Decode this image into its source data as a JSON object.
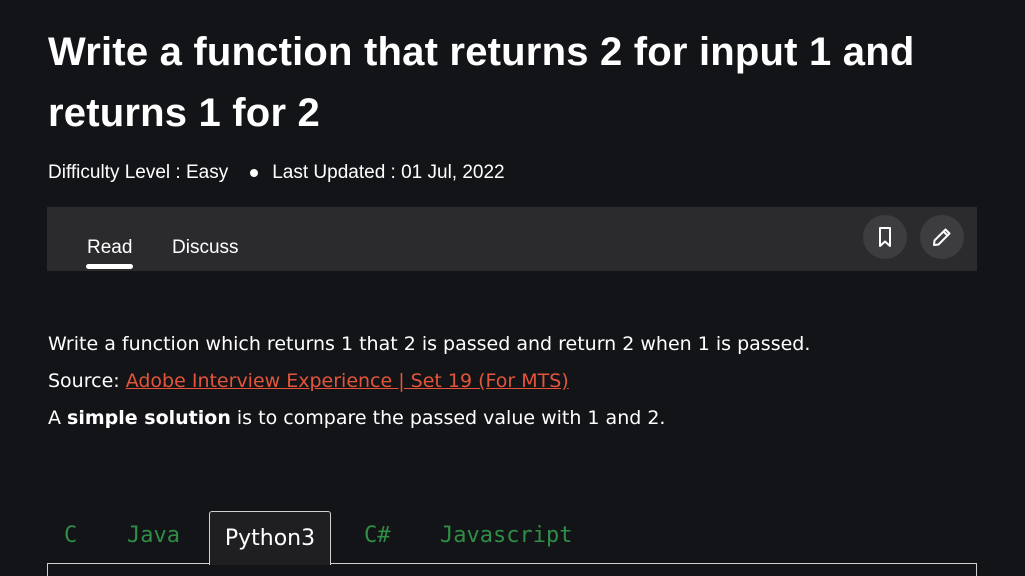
{
  "article": {
    "title": "Write a function that returns 2 for input 1 and returns 1 for 2",
    "difficulty": "Difficulty Level : Easy",
    "last_updated": "Last Updated : 01 Jul, 2022"
  },
  "toolbar": {
    "tabs": [
      {
        "label": "Read"
      },
      {
        "label": "Discuss"
      }
    ],
    "bookmark_icon": "bookmark-icon",
    "edit_icon": "pencil-icon"
  },
  "content": {
    "line1": "Write a function which returns 1 that 2 is passed and return 2 when 1 is passed.",
    "source_prefix": "Source: ",
    "source_link": "Adobe Interview Experience | Set 19 (For MTS)",
    "line3_prefix": "A ",
    "line3_bold": "simple solution",
    "line3_rest": " is to compare the passed value with 1 and 2."
  },
  "code_tabs": {
    "items": [
      {
        "label": "C"
      },
      {
        "label": "Java"
      },
      {
        "label": "Python3"
      },
      {
        "label": "C#"
      },
      {
        "label": "Javascript"
      }
    ],
    "active": "Python3"
  },
  "colors": {
    "background": "#131417",
    "link": "#e2553b",
    "lang_tab": "#2f8d46",
    "toolbar": "#2b2b2d"
  }
}
